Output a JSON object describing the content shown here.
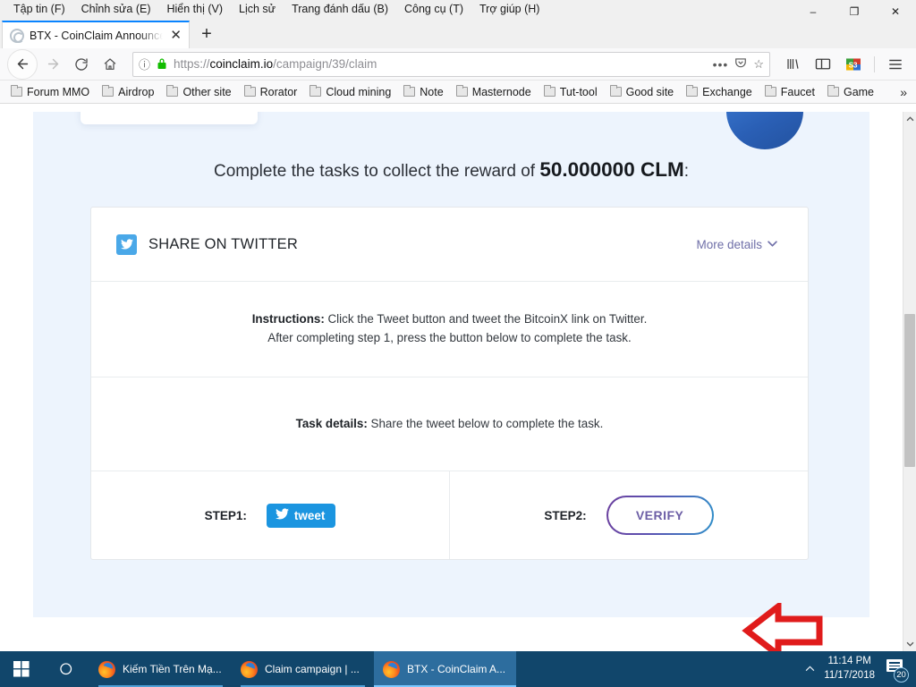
{
  "window": {
    "menus": [
      {
        "label": "Tập tin (F)"
      },
      {
        "label": "Chỉnh sửa (E)"
      },
      {
        "label": "Hiển thị (V)"
      },
      {
        "label": "Lịch sử"
      },
      {
        "label": "Trang đánh dấu (B)"
      },
      {
        "label": "Công cụ (T)"
      },
      {
        "label": "Trợ giúp (H)"
      }
    ],
    "controls": {
      "minimize": "–",
      "maximize": "❐",
      "close": "✕"
    }
  },
  "tabs": {
    "active": {
      "title": "BTX - CoinClaim Announce Sha",
      "close_label": "✕"
    },
    "new_tab_label": "+"
  },
  "toolbar": {
    "back_label": "←",
    "forward_label": "→",
    "reload_label": "⟳",
    "home_label": "⌂",
    "identity_label": "ⓘ",
    "lock_label": "lock-icon",
    "page_actions_label": "•••",
    "pocket_label": "pocket-icon",
    "bookmark_star_label": "☆",
    "library_label": "library-icon",
    "sidebar_label": "sidebar-icon",
    "extension_label": "S3",
    "menu_label": "☰"
  },
  "address": {
    "scheme": "https://",
    "host": "coinclaim.io",
    "path": "/campaign/39/claim"
  },
  "bookmarks": {
    "items": [
      {
        "label": "Forum MMO"
      },
      {
        "label": "Airdrop"
      },
      {
        "label": "Other site"
      },
      {
        "label": "Rorator"
      },
      {
        "label": "Cloud mining"
      },
      {
        "label": "Note"
      },
      {
        "label": "Masternode"
      },
      {
        "label": "Tut-tool"
      },
      {
        "label": "Good site"
      },
      {
        "label": "Exchange"
      },
      {
        "label": "Faucet"
      },
      {
        "label": "Game"
      }
    ],
    "overflow_label": "»"
  },
  "page": {
    "reward_prefix": "Complete the tasks to collect the reward of ",
    "reward_amount": "50.000000 CLM",
    "reward_suffix": ":",
    "task": {
      "icon_name": "twitter-icon",
      "title": "SHARE ON TWITTER",
      "more_details_label": "More details",
      "more_details_chevron": "⌄",
      "instructions_label": "Instructions:",
      "instructions_line1": " Click the Tweet button and tweet the BitcoinX link on Twitter.",
      "instructions_line2": "After completing step 1, press the button below to complete the task.",
      "task_details_label": "Task details:",
      "task_details_text": " Share the tweet below to complete the task.",
      "step1_label": "STEP1:",
      "tweet_button_label": "tweet",
      "step2_label": "STEP2:",
      "verify_button_label": "VERIFY"
    },
    "colors": {
      "page_background": "#edf4fd",
      "twitter_blue": "#1b95e0",
      "verify_text": "#6d5fa6",
      "annotation_red": "#e01b1b"
    }
  },
  "scrollbar": {
    "up_label": "⌃",
    "down_label": "⌄"
  },
  "taskbar": {
    "start_label": "start-icon",
    "search_label": "search-icon",
    "items": [
      {
        "label": "Kiếm Tiền Trên Mạ...",
        "active": false
      },
      {
        "label": "Claim campaign | ...",
        "active": false
      },
      {
        "label": "BTX - CoinClaim A...",
        "active": true
      }
    ],
    "tray_caret": "⌃",
    "time": "11:14 PM",
    "date": "11/17/2018",
    "notification_count": "20"
  }
}
